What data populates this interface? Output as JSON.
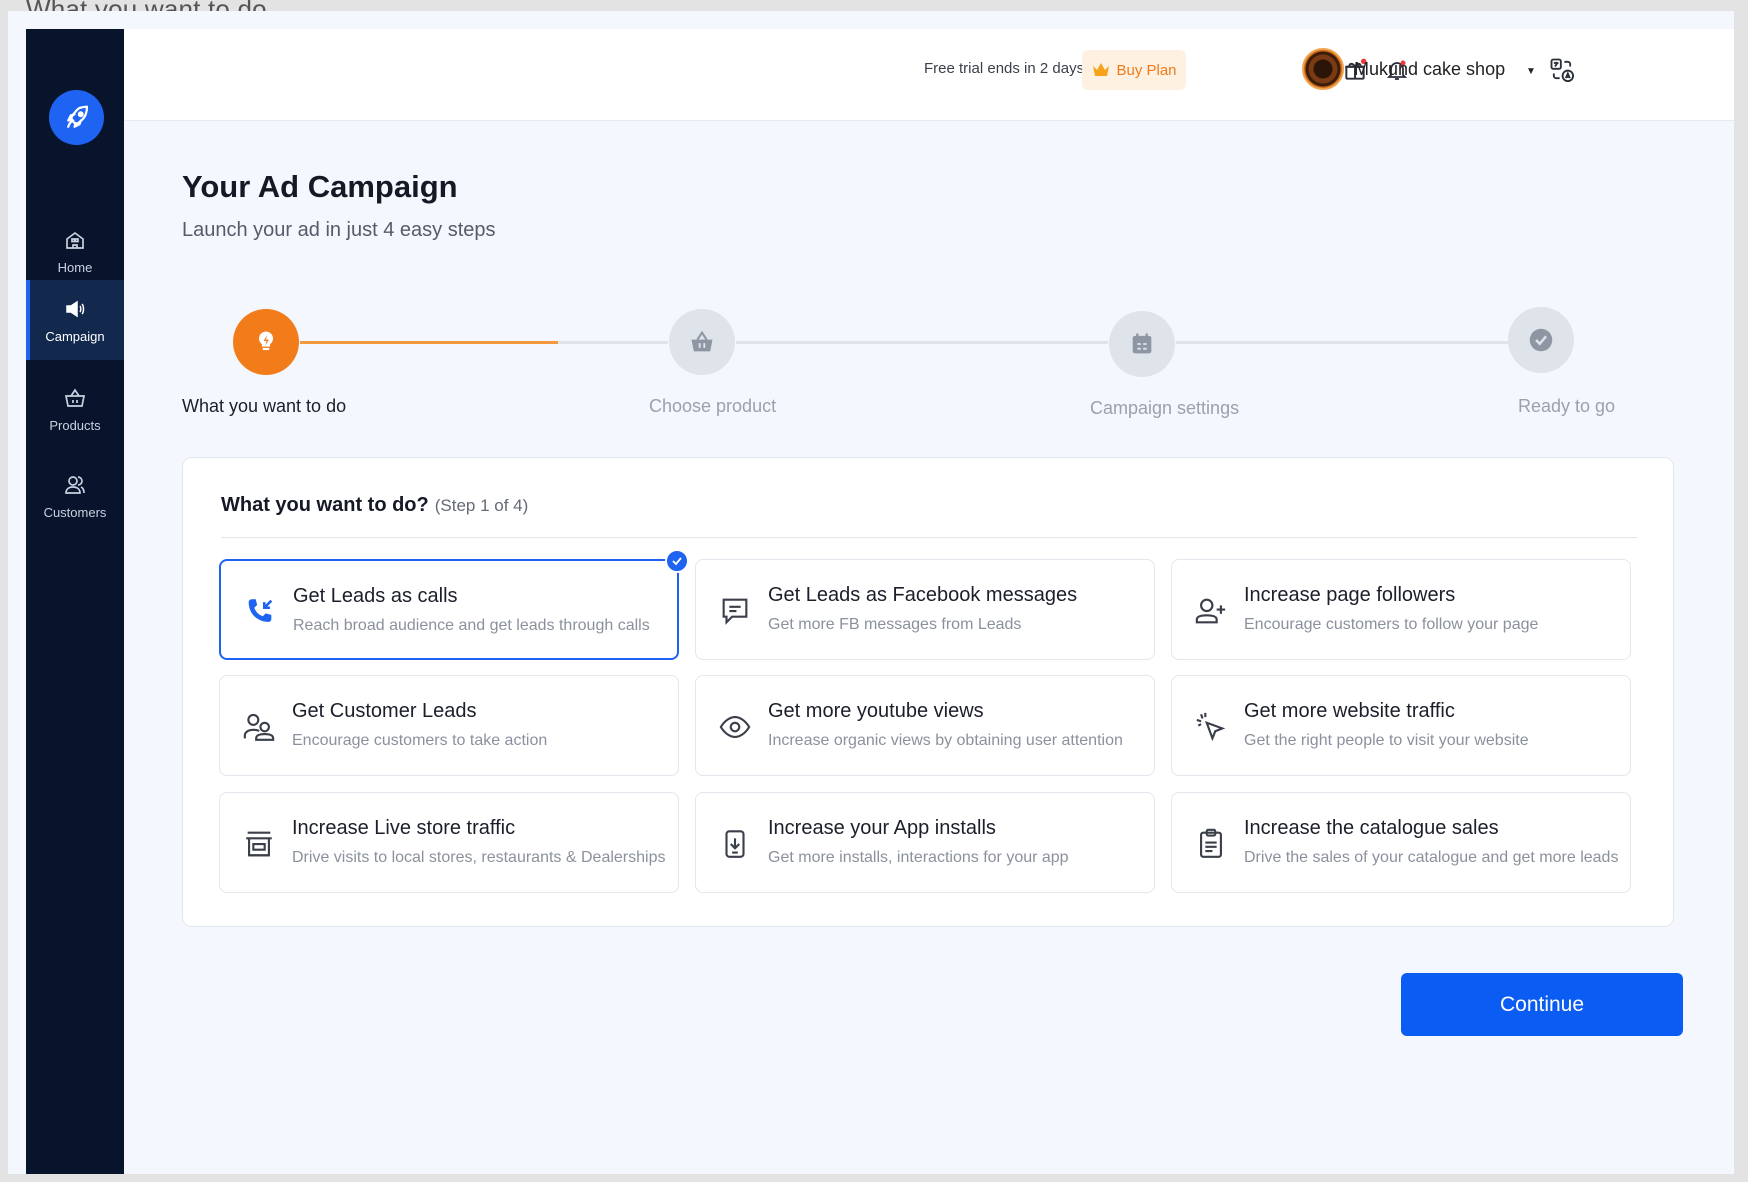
{
  "frame_caption": "What you want to do",
  "sidebar": {
    "items": [
      {
        "label": "Home"
      },
      {
        "label": "Campaign"
      },
      {
        "label": "Products"
      },
      {
        "label": "Customers"
      }
    ]
  },
  "header": {
    "trial_text": "Free trial ends in 2 days",
    "buy_plan_label": "Buy Plan",
    "shop_name": "Mukund cake shop",
    "shop_caret": "▼"
  },
  "main": {
    "title": "Your Ad Campaign",
    "subtitle": "Launch your ad in just 4 easy steps"
  },
  "stepper": {
    "steps": [
      {
        "label": "What you want to do",
        "active": true
      },
      {
        "label": "Choose product",
        "active": false
      },
      {
        "label": "Campaign settings",
        "active": false
      },
      {
        "label": "Ready to go",
        "active": false
      }
    ]
  },
  "card": {
    "title": "What you want to do?",
    "step_text": "(Step 1 of 4)",
    "options": [
      {
        "title": "Get Leads as calls",
        "desc": "Reach broad audience and get leads through calls",
        "icon": "phone-incoming-icon",
        "selected": true
      },
      {
        "title": "Get Leads as Facebook messages",
        "desc": "Get more FB messages from Leads",
        "icon": "message-icon",
        "selected": false
      },
      {
        "title": "Increase page followers",
        "desc": "Encourage customers to follow your page",
        "icon": "user-plus-icon",
        "selected": false
      },
      {
        "title": "Get Customer Leads",
        "desc": "Encourage customers to take action",
        "icon": "users-icon",
        "selected": false
      },
      {
        "title": "Get more youtube views",
        "desc": "Increase organic views by obtaining user attention",
        "icon": "eye-icon",
        "selected": false
      },
      {
        "title": "Get more website traffic",
        "desc": "Get the right people to visit your website",
        "icon": "cursor-click-icon",
        "selected": false
      },
      {
        "title": "Increase Live store traffic",
        "desc": "Drive visits to local stores, restaurants & Dealerships",
        "icon": "store-icon",
        "selected": false
      },
      {
        "title": "Increase your App installs",
        "desc": "Get more installs, interactions for your app",
        "icon": "app-download-icon",
        "selected": false
      },
      {
        "title": "Increase the catalogue sales",
        "desc": "Drive the sales of your catalogue and get more leads",
        "icon": "clipboard-icon",
        "selected": false
      }
    ]
  },
  "continue_label": "Continue",
  "colors": {
    "primary": "#1f63f2",
    "accent_orange": "#f27b1a",
    "sidebar_bg": "#08142b"
  }
}
